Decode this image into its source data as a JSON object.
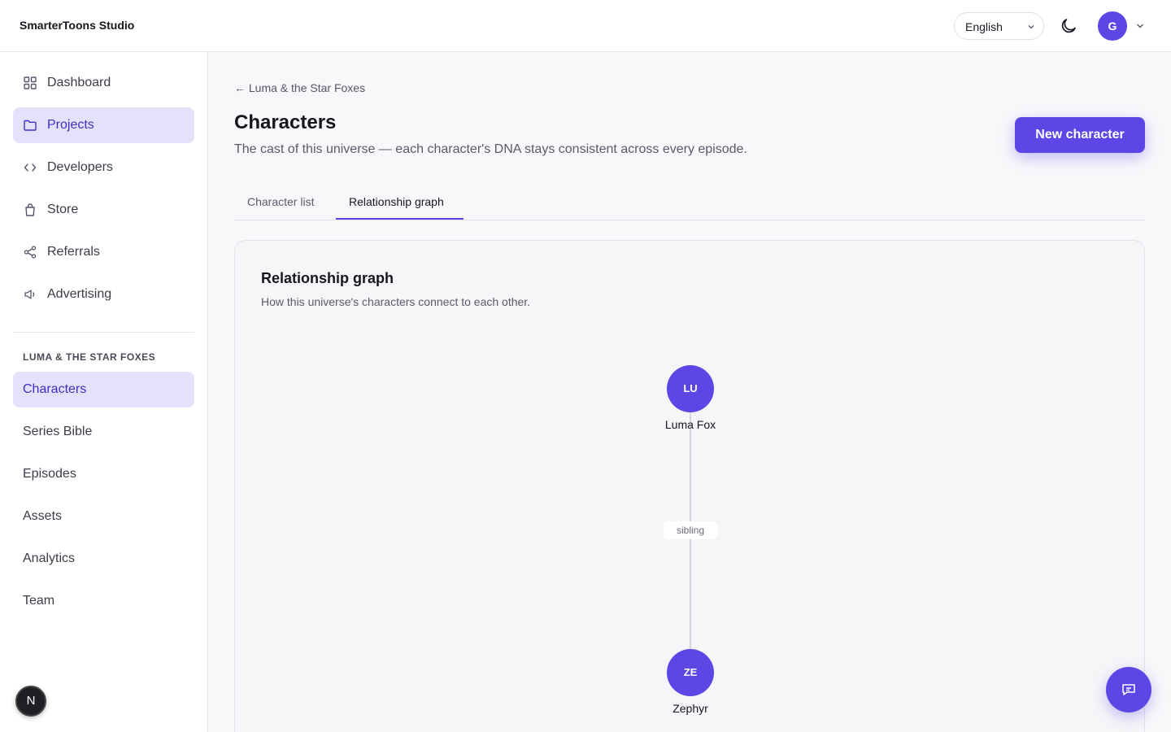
{
  "app": {
    "brand": "SmarterToons Studio"
  },
  "header": {
    "language": "English",
    "avatar_initial": "G"
  },
  "sidebar": {
    "items": [
      {
        "label": "Dashboard",
        "icon": "grid-icon"
      },
      {
        "label": "Projects",
        "icon": "folder-icon",
        "active": true
      },
      {
        "label": "Developers",
        "icon": "code-icon"
      },
      {
        "label": "Store",
        "icon": "shopping-bag-icon"
      },
      {
        "label": "Referrals",
        "icon": "share-icon"
      },
      {
        "label": "Advertising",
        "icon": "megaphone-icon"
      }
    ],
    "section_title": "LUMA & THE STAR FOXES",
    "project_items": [
      {
        "label": "Characters",
        "active": true
      },
      {
        "label": "Series Bible"
      },
      {
        "label": "Episodes"
      },
      {
        "label": "Assets"
      },
      {
        "label": "Analytics"
      },
      {
        "label": "Team"
      }
    ],
    "badge": "N"
  },
  "main": {
    "back_link": "← Luma & the Star Foxes",
    "title": "Characters",
    "description": "The cast of this universe — each character's DNA stays consistent across every episode.",
    "new_button": "New character",
    "tabs": [
      {
        "label": "Character list",
        "active": false
      },
      {
        "label": "Relationship graph",
        "active": true
      }
    ],
    "graph": {
      "title": "Relationship graph",
      "description": "How this universe's characters connect to each other.",
      "nodes": [
        {
          "initials": "LU",
          "name": "Luma Fox"
        },
        {
          "initials": "ZE",
          "name": "Zephyr"
        }
      ],
      "edges": [
        {
          "label": "sibling"
        }
      ]
    }
  },
  "colors": {
    "accent": "#5b47e6",
    "active_bg": "#e4e2fb"
  }
}
